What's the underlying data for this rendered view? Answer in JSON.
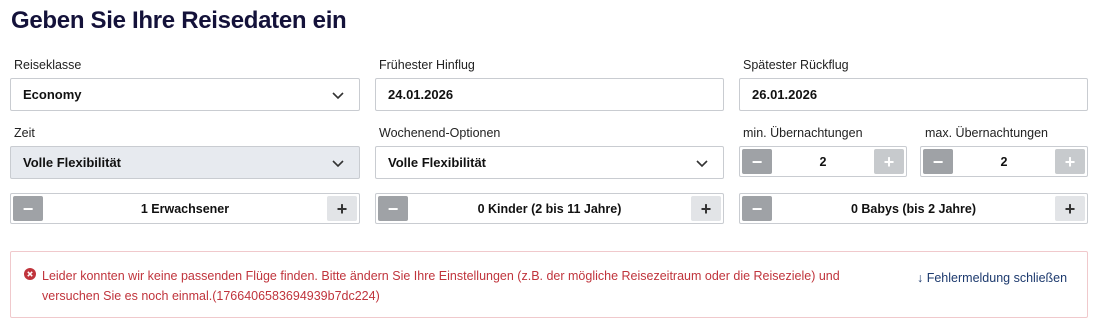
{
  "page": {
    "title": "Geben Sie Ihre Reisedaten ein"
  },
  "form": {
    "reiseklasse": {
      "label": "Reiseklasse",
      "value": "Economy"
    },
    "hinflug": {
      "label": "Frühester Hinflug",
      "value": "24.01.2026"
    },
    "rueckflug": {
      "label": "Spätester Rückflug",
      "value": "26.01.2026"
    },
    "zeit": {
      "label": "Zeit",
      "value": "Volle Flexibilität"
    },
    "wochenende": {
      "label": "Wochenend-Optionen",
      "value": "Volle Flexibilität"
    },
    "min_nights": {
      "label": "min. Übernachtungen",
      "value": "2"
    },
    "max_nights": {
      "label": "max. Übernachtungen",
      "value": "2"
    },
    "erwachsene": {
      "value": "1 Erwachsener"
    },
    "kinder": {
      "value": "0 Kinder (2 bis 11 Jahre)"
    },
    "babys": {
      "value": "0 Babys (bis 2 Jahre)"
    },
    "minus_glyph": "−",
    "plus_glyph": "+"
  },
  "error": {
    "message": "Leider konnten wir keine passenden Flüge finden. Bitte ändern Sie Ihre Einstellungen (z.B. der mögliche Reisezeitraum oder die Reiseziele) und versuchen Sie es noch einmal.(1766406583694939b7dc224)",
    "close_label": "↓ Fehlermeldung schließen",
    "color": "#c0343c"
  },
  "icons": {
    "select": "chevron-down-icon",
    "error": "error-circle-icon"
  }
}
